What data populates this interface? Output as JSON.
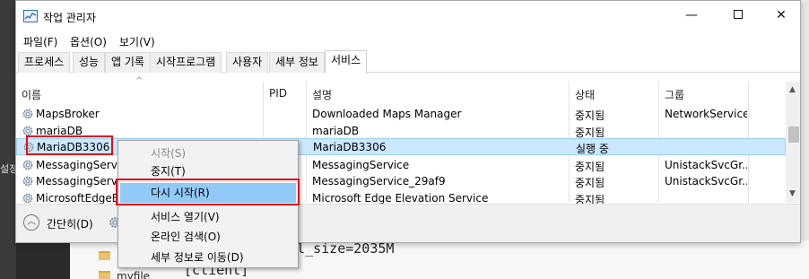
{
  "window": {
    "title": "작업 관리자",
    "controls": {
      "minimize": "—",
      "close": "✕"
    }
  },
  "menubar": [
    "파일(F)",
    "옵션(O)",
    "보기(V)"
  ],
  "tabs": [
    "프로세스",
    "성능",
    "앱 기록",
    "시작프로그램",
    "사용자",
    "세부 정보",
    "서비스"
  ],
  "active_tab": "서비스",
  "table": {
    "columns": [
      "이름",
      "PID",
      "설명",
      "상태",
      "그룹"
    ],
    "rows": [
      {
        "name": "MapsBroker",
        "pid": "",
        "desc": "Downloaded Maps Manager",
        "status": "중지됨",
        "group": "NetworkService"
      },
      {
        "name": "mariaDB",
        "pid": "",
        "desc": "mariaDB",
        "status": "중지됨",
        "group": ""
      },
      {
        "name": "MariaDB3306",
        "pid": "",
        "desc": "MariaDB3306",
        "status": "실행 중",
        "group": "",
        "selected": true
      },
      {
        "name": "MessagingService",
        "pid": "",
        "desc": "MessagingService",
        "status": "중지됨",
        "group": "UnistackSvcGr..."
      },
      {
        "name": "MessagingService",
        "pid": "",
        "desc": "MessagingService_29af9",
        "status": "중지됨",
        "group": "UnistackSvcGr..."
      },
      {
        "name": "MicrosoftEdgeElev",
        "pid": "",
        "desc": "Microsoft Edge Elevation Service",
        "status": "중지됨",
        "group": ""
      }
    ]
  },
  "statusbar": {
    "collapse_label": "간단히(D)"
  },
  "context_menu": {
    "items": [
      {
        "label": "시작(S)",
        "disabled": true
      },
      {
        "label": "중지(T)"
      },
      {
        "label": "다시 시작(R)",
        "hover": true
      },
      {
        "label": "서비스 열기(V)"
      },
      {
        "label": "온라인 검색(O)"
      },
      {
        "label": "세부 정보로 이동(D)"
      }
    ]
  },
  "background": {
    "left_label": "설정",
    "code_line1": "pol_size=2035M",
    "code_line2": "[client]",
    "folder_item": "myfile"
  },
  "colors": {
    "selected_row": "#cce8ff",
    "menu_hover": "#91c9f7",
    "highlight": "#e0101a"
  }
}
